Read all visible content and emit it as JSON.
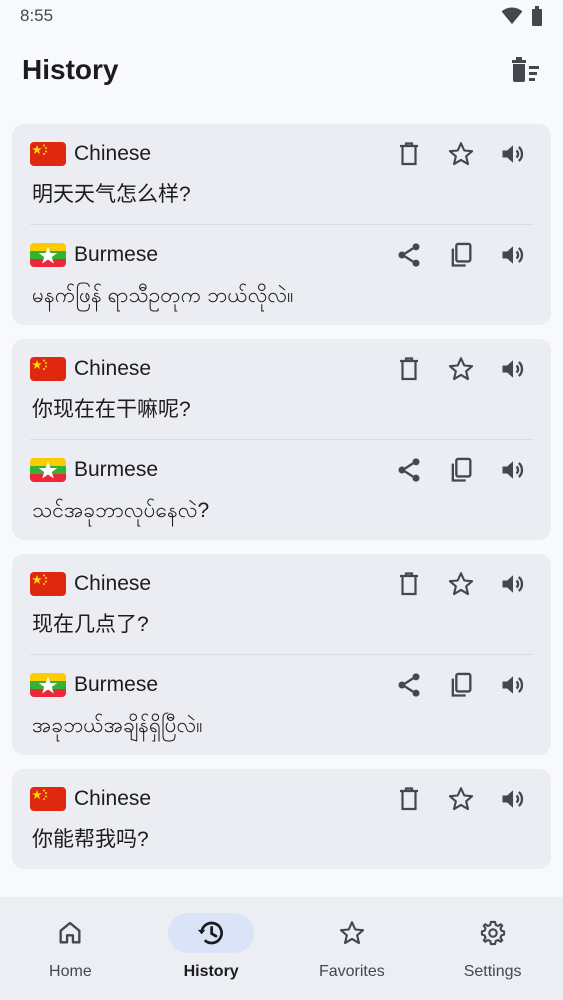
{
  "status": {
    "time": "8:55"
  },
  "app": {
    "title": "History"
  },
  "history": [
    {
      "source": {
        "lang": "Chinese",
        "flag": "china-flag-icon",
        "text": "明天天气怎么样?"
      },
      "target": {
        "lang": "Burmese",
        "flag": "myanmar-flag-icon",
        "text": "မနက်ဖြန် ရာသီဥတုက ဘယ်လိုလဲ။"
      }
    },
    {
      "source": {
        "lang": "Chinese",
        "flag": "china-flag-icon",
        "text": "你现在在干嘛呢?"
      },
      "target": {
        "lang": "Burmese",
        "flag": "myanmar-flag-icon",
        "text": "သင်အခုဘာလုပ်နေလဲ?"
      }
    },
    {
      "source": {
        "lang": "Chinese",
        "flag": "china-flag-icon",
        "text": "现在几点了?"
      },
      "target": {
        "lang": "Burmese",
        "flag": "myanmar-flag-icon",
        "text": "အခုဘယ်အချိန်ရှိပြီလဲ။"
      }
    },
    {
      "source": {
        "lang": "Chinese",
        "flag": "china-flag-icon",
        "text": "你能帮我吗?"
      }
    }
  ],
  "nav": {
    "home": "Home",
    "history": "History",
    "favorites": "Favorites",
    "settings": "Settings",
    "active": "history"
  },
  "colors": {
    "accent_pill": "#dae3f8",
    "card": "#ecedf2",
    "background": "#f8f9fd"
  }
}
